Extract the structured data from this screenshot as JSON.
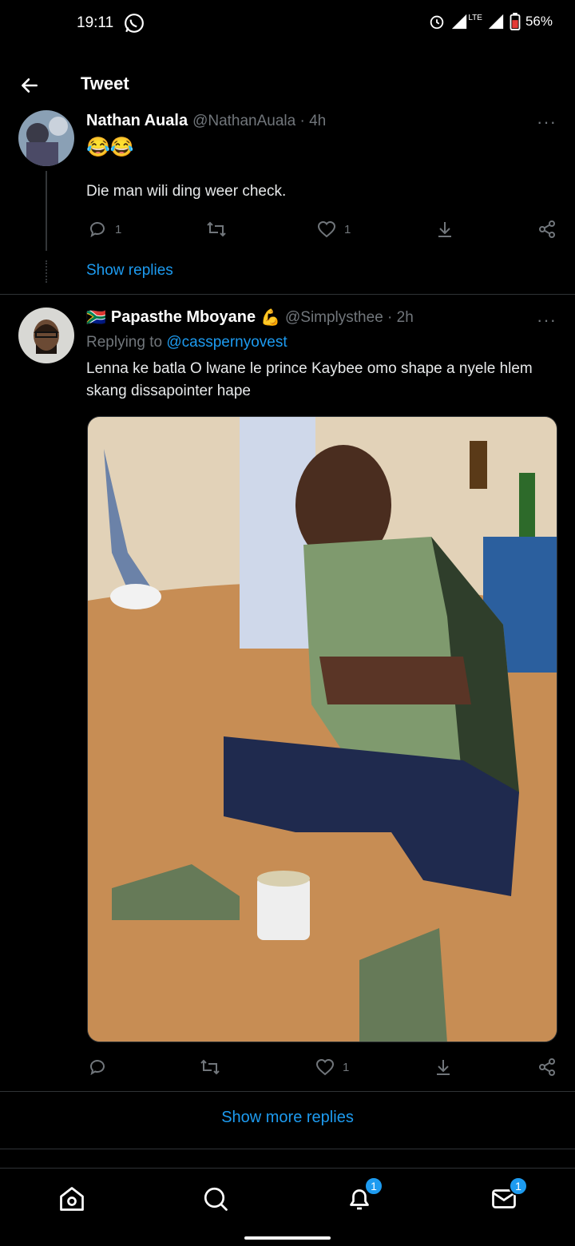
{
  "status_bar": {
    "time": "19:11",
    "network": "LTE",
    "battery": "56%"
  },
  "header": {
    "title": "Tweet"
  },
  "tweet1": {
    "name": "Nathan Auala",
    "handle": "@NathanAuala · 4h",
    "emoji": "😂😂",
    "text": "Die man wili ding weer check.",
    "reply_count": "1",
    "like_count": "1",
    "show_replies": "Show replies"
  },
  "tweet2": {
    "flag": "🇿🇦",
    "name": "Papasthe Mboyane",
    "badge_emoji": "💪",
    "handle": "@Simplysthee · 2h",
    "replying_prefix": "Replying to",
    "replying_to": "@casspernyovest",
    "text": "Lenna ke batla O lwane le prince Kaybee omo shape a nyele hlem skang dissapointer hape",
    "like_count": "1"
  },
  "show_more_replies": "Show more replies",
  "bottom_nav": {
    "notifications_badge": "1",
    "messages_badge": "1"
  },
  "colors": {
    "accent": "#1d9bf0",
    "muted": "#71767b",
    "background": "#000000"
  }
}
